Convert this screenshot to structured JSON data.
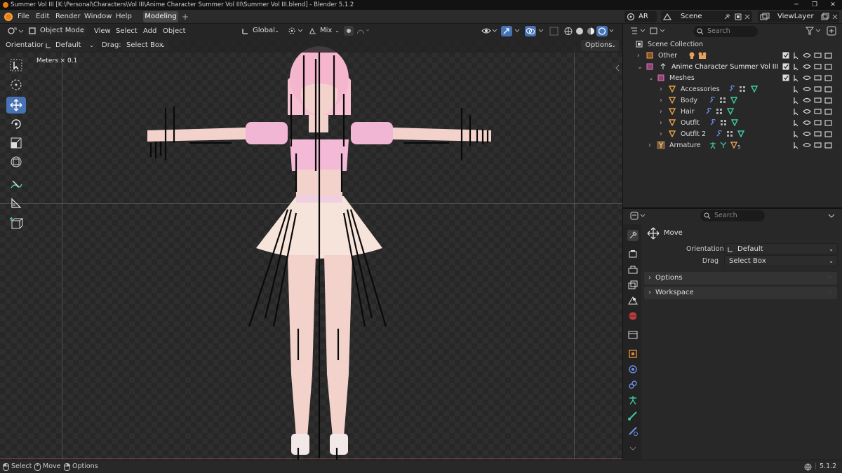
{
  "window": {
    "title": "Summer Vol III [K:\\Personal\\Characters\\Vol III\\Anime Character Summer Vol III\\Summer Vol III.blend] - Blender 5.1.2",
    "min": "─",
    "max": "❐",
    "close": "✕"
  },
  "menu": {
    "items": [
      "File",
      "Edit",
      "Render",
      "Window",
      "Help"
    ],
    "workspace_tab": "Modeling",
    "add_tab": "+"
  },
  "scene": {
    "ar_label": "AR",
    "scene_name": "Scene",
    "view_layer": "ViewLayer"
  },
  "viewport": {
    "mode": "Object Mode",
    "menus": [
      "View",
      "Select",
      "Add",
      "Object"
    ],
    "transform_orientation": "Global",
    "snap_mode": "Mix",
    "orientation_label": "Orientation:",
    "orientation_value": "Default",
    "drag_label": "Drag:",
    "drag_value": "Select Box",
    "options_label": "Options",
    "grid_scale_text": "Meters × 0.1"
  },
  "outliner": {
    "search_placeholder": "Search",
    "rows": [
      {
        "name": "Scene Collection"
      },
      {
        "name": "Other"
      },
      {
        "name": "Anime Character Summer Vol III"
      },
      {
        "name": "Meshes"
      },
      {
        "name": "Accessories"
      },
      {
        "name": "Body"
      },
      {
        "name": "Hair"
      },
      {
        "name": "Outfit"
      },
      {
        "name": "Outfit 2"
      },
      {
        "name": "Armature"
      }
    ],
    "armature_count": "5"
  },
  "properties": {
    "search_placeholder": "Search",
    "tool_name": "Move",
    "orientation_label": "Orientation",
    "orientation_value": "Default",
    "drag_label": "Drag",
    "drag_value": "Select Box",
    "panels": [
      "Options",
      "Workspace"
    ]
  },
  "statusbar": {
    "select": "Select",
    "move": "Move",
    "options": "Options",
    "version": "5.1.2"
  },
  "colors": {
    "accent": "#4772b3",
    "collection": "#e0e0e0",
    "mesh": "#e09c4d",
    "modifier": "#6b8ee8",
    "material": "#3ec7a0",
    "armature_x": "#e0a070",
    "collection_pink": "#e96fc0"
  }
}
